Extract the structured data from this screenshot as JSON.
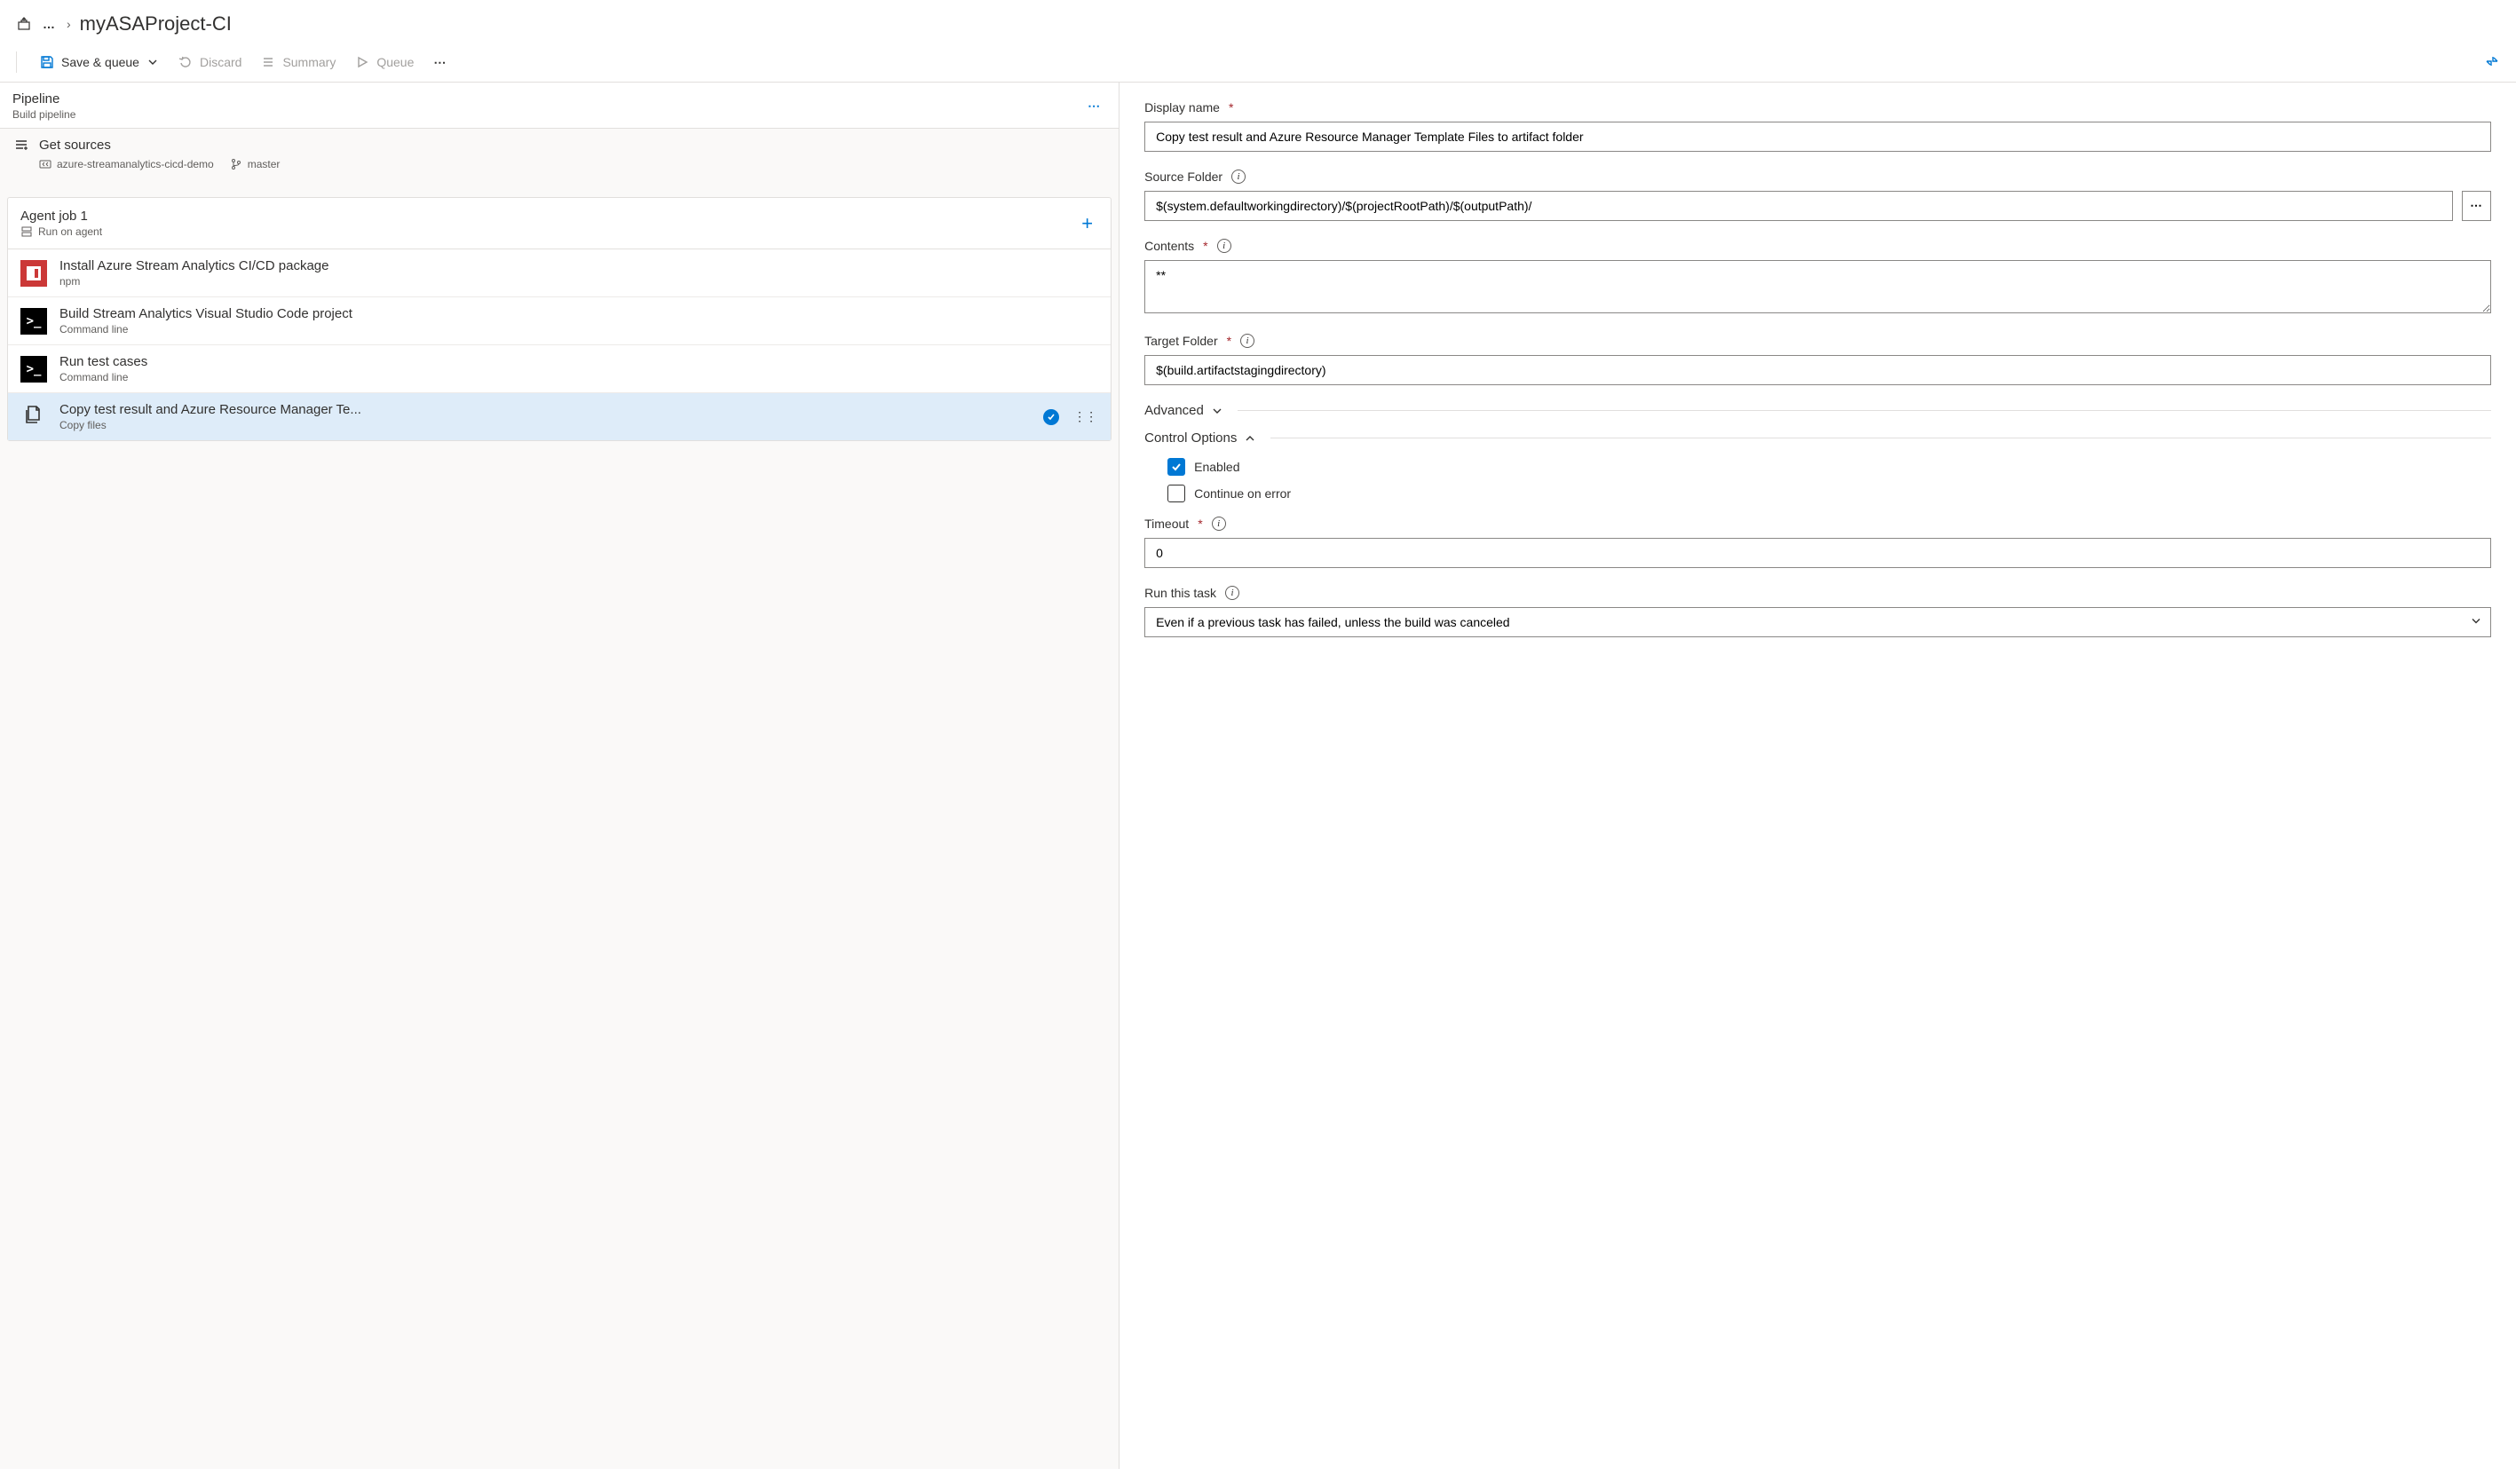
{
  "breadcrumb": {
    "ellipsis": "…",
    "title": "myASAProject-CI"
  },
  "toolbar": {
    "save_queue": "Save & queue",
    "discard": "Discard",
    "summary": "Summary",
    "queue": "Queue"
  },
  "left": {
    "pipeline": {
      "title": "Pipeline",
      "sub": "Build pipeline"
    },
    "get_sources": {
      "title": "Get sources",
      "repo": "azure-streamanalytics-cicd-demo",
      "branch": "master"
    },
    "agent": {
      "title": "Agent job 1",
      "sub": "Run on agent"
    },
    "tasks": [
      {
        "icon": "npm",
        "title": "Install Azure Stream Analytics CI/CD package",
        "sub": "npm"
      },
      {
        "icon": "cmd",
        "title": "Build Stream Analytics Visual Studio Code project",
        "sub": "Command line"
      },
      {
        "icon": "cmd",
        "title": "Run test cases",
        "sub": "Command line"
      },
      {
        "icon": "copy",
        "title": "Copy test result and Azure Resource Manager Te...",
        "sub": "Copy files",
        "selected": true
      }
    ]
  },
  "form": {
    "display_name_label": "Display name",
    "display_name": "Copy test result and Azure Resource Manager Template Files to artifact folder",
    "source_folder_label": "Source Folder",
    "source_folder": "$(system.defaultworkingdirectory)/$(projectRootPath)/$(outputPath)/",
    "contents_label": "Contents",
    "contents": "**",
    "target_folder_label": "Target Folder",
    "target_folder": "$(build.artifactstagingdirectory)",
    "advanced": "Advanced",
    "control_options": "Control Options",
    "enabled_label": "Enabled",
    "continue_label": "Continue on error",
    "timeout_label": "Timeout",
    "timeout": "0",
    "run_task_label": "Run this task",
    "run_task": "Even if a previous task has failed, unless the build was canceled"
  }
}
